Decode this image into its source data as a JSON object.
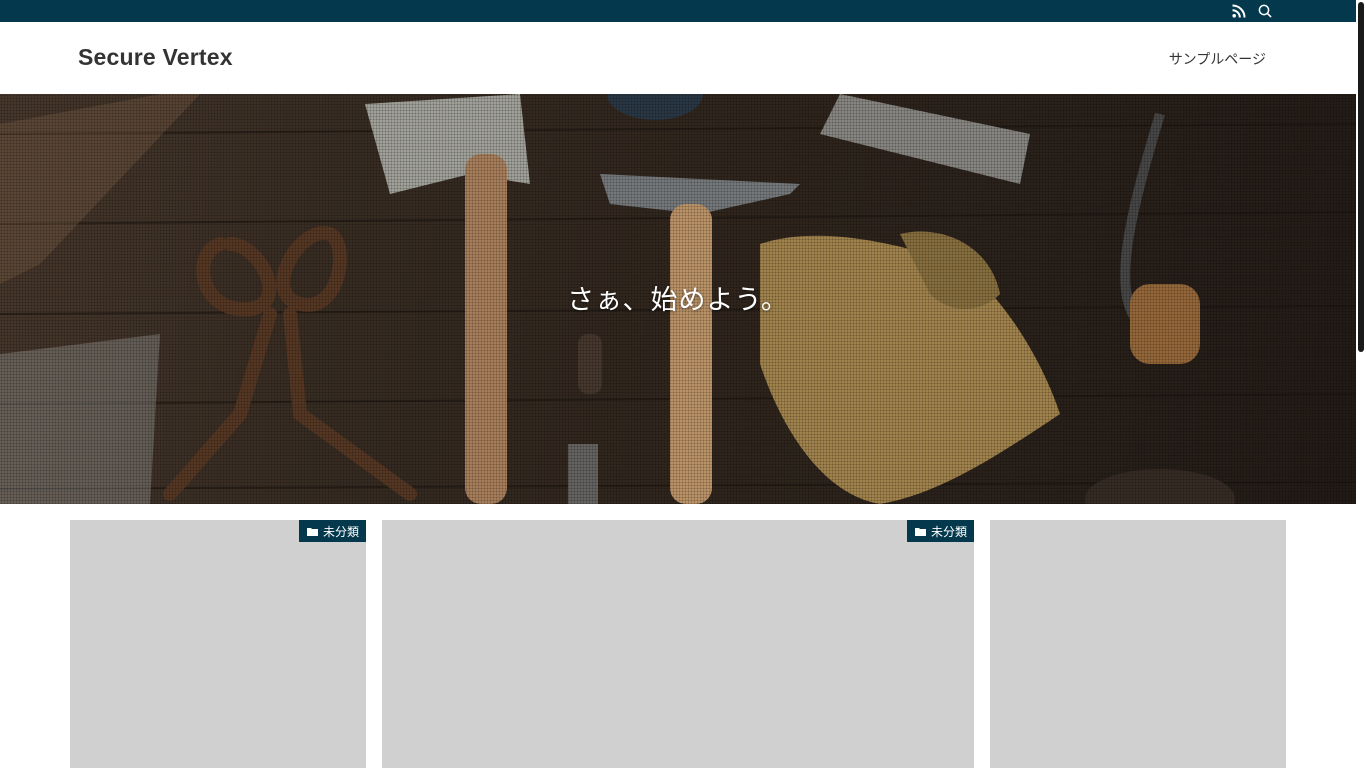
{
  "topbar": {
    "icons": [
      "rss-icon",
      "search-icon"
    ],
    "background": "#04384c"
  },
  "header": {
    "site_title": "Secure Vertex",
    "nav": [
      {
        "label": "サンプルページ"
      }
    ]
  },
  "hero": {
    "title": "さぁ、始めよう。"
  },
  "posts": [
    {
      "category": "未分類",
      "category_icon": "folder-icon"
    },
    {
      "category": "未分類",
      "category_icon": "folder-icon"
    },
    {
      "category": null
    }
  ],
  "colors": {
    "accent": "#04384c",
    "card_placeholder": "#d0d0d0"
  }
}
